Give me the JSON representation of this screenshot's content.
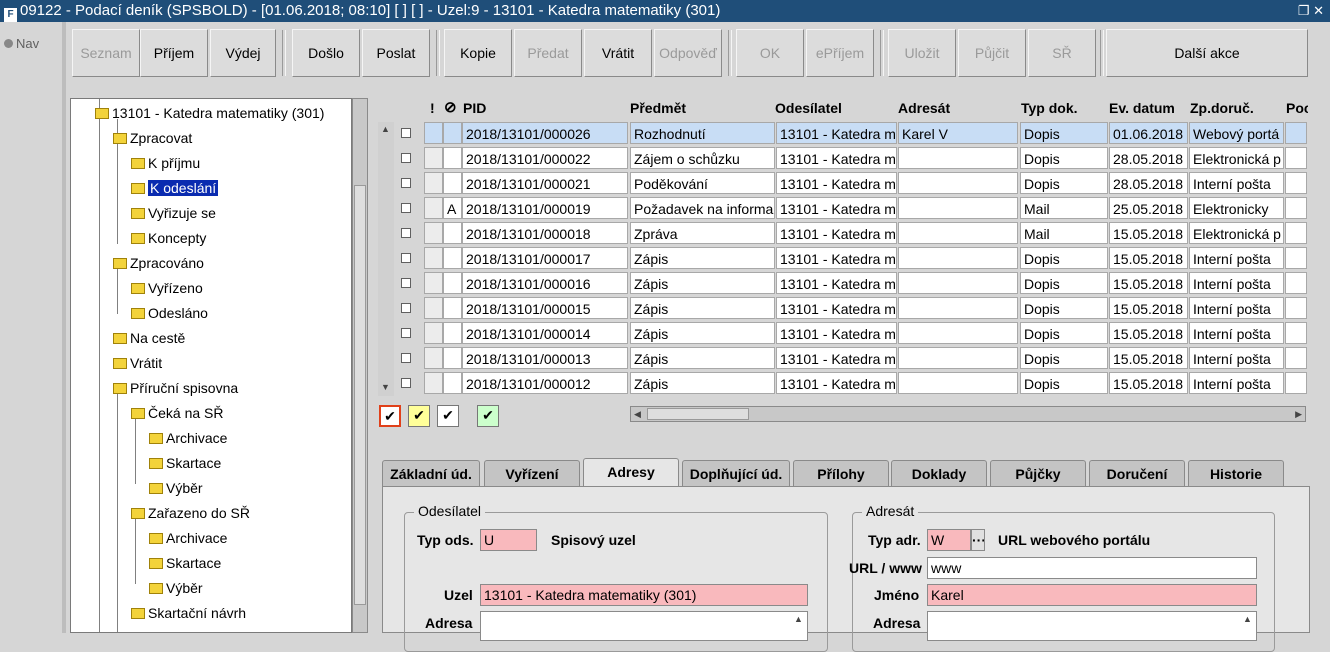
{
  "window": {
    "title": "09122 - Podací deník (SPSBOLD) - [01.06.2018; 08:10]  [ ]  [ ] - Uzel:9 - 13101 - Katedra  matematiky (301)",
    "icon": "app-icon"
  },
  "nav_label": "Nav",
  "toolbar": {
    "buttons": [
      {
        "label": "Seznam",
        "enabled": false
      },
      {
        "label": "Příjem",
        "enabled": true
      },
      {
        "label": "Výdej",
        "enabled": true
      },
      {
        "label": "Došlo",
        "enabled": true
      },
      {
        "label": "Poslat",
        "enabled": true
      },
      {
        "label": "Kopie",
        "enabled": true
      },
      {
        "label": "Předat",
        "enabled": false
      },
      {
        "label": "Vrátit",
        "enabled": true
      },
      {
        "label": "Odpověď",
        "enabled": false
      },
      {
        "label": "OK",
        "enabled": false
      },
      {
        "label": "ePříjem",
        "enabled": false
      },
      {
        "label": "Uložit",
        "enabled": false
      },
      {
        "label": "Půjčit",
        "enabled": false
      },
      {
        "label": "SŘ",
        "enabled": false
      },
      {
        "label": "Další akce",
        "enabled": true
      }
    ]
  },
  "tree": {
    "nodes": [
      {
        "label": "13101 - Katedra  matematiky (301)",
        "level": 0
      },
      {
        "label": "Zpracovat",
        "level": 1
      },
      {
        "label": "K příjmu",
        "level": 2
      },
      {
        "label": "K odeslání",
        "level": 2,
        "selected": true
      },
      {
        "label": "Vyřizuje se",
        "level": 2
      },
      {
        "label": "Koncepty",
        "level": 2
      },
      {
        "label": "Zpracováno",
        "level": 1
      },
      {
        "label": "Vyřízeno",
        "level": 2
      },
      {
        "label": "Odesláno",
        "level": 2
      },
      {
        "label": "Na cestě",
        "level": 1
      },
      {
        "label": "Vrátit",
        "level": 1
      },
      {
        "label": "Příruční spisovna",
        "level": 1
      },
      {
        "label": "Čeká na SŘ",
        "level": 2
      },
      {
        "label": "Archivace",
        "level": 3
      },
      {
        "label": "Skartace",
        "level": 3
      },
      {
        "label": "Výběr",
        "level": 3
      },
      {
        "label": "Zařazeno do SŘ",
        "level": 2
      },
      {
        "label": "Archivace",
        "level": 3
      },
      {
        "label": "Skartace",
        "level": 3
      },
      {
        "label": "Výběr",
        "level": 3
      },
      {
        "label": "Skartační návrh",
        "level": 2
      }
    ]
  },
  "grid": {
    "headers": [
      "!",
      "PID",
      "Předmět",
      "Odesílatel",
      "Adresát",
      "Typ dok.",
      "Ev. datum",
      "Zp.doruč.",
      "Poc"
    ],
    "rows": [
      {
        "flag": "",
        "pid": "2018/13101/000026",
        "predmet": "Rozhodnutí",
        "odesilatel": "13101 - Katedra  m",
        "adresat": "Karel V",
        "typ": "Dopis",
        "datum": "01.06.2018",
        "zp": "Webový portá",
        "selected": true
      },
      {
        "flag": "",
        "pid": "2018/13101/000022",
        "predmet": "Zájem o schůzku",
        "odesilatel": "13101 - Katedra  m",
        "adresat": "",
        "typ": "Dopis",
        "datum": "28.05.2018",
        "zp": "Elektronická p"
      },
      {
        "flag": "",
        "pid": "2018/13101/000021",
        "predmet": "Poděkování",
        "odesilatel": "13101 - Katedra  m",
        "adresat": "",
        "typ": "Dopis",
        "datum": "28.05.2018",
        "zp": "Interní pošta"
      },
      {
        "flag": "A",
        "pid": "2018/13101/000019",
        "predmet": "Požadavek na informa",
        "odesilatel": "13101 - Katedra  m",
        "adresat": "",
        "typ": "Mail",
        "datum": "25.05.2018",
        "zp": "Elektronicky"
      },
      {
        "flag": "",
        "pid": "2018/13101/000018",
        "predmet": "Zpráva",
        "odesilatel": "13101 - Katedra  m",
        "adresat": "",
        "typ": "Mail",
        "datum": "15.05.2018",
        "zp": "Elektronická p"
      },
      {
        "flag": "",
        "pid": "2018/13101/000017",
        "predmet": "Zápis",
        "odesilatel": "13101 - Katedra  m",
        "adresat": "",
        "typ": "Dopis",
        "datum": "15.05.2018",
        "zp": "Interní pošta"
      },
      {
        "flag": "",
        "pid": "2018/13101/000016",
        "predmet": "Zápis",
        "odesilatel": "13101 - Katedra  m",
        "adresat": "",
        "typ": "Dopis",
        "datum": "15.05.2018",
        "zp": "Interní pošta"
      },
      {
        "flag": "",
        "pid": "2018/13101/000015",
        "predmet": "Zápis",
        "odesilatel": "13101 - Katedra  m",
        "adresat": "",
        "typ": "Dopis",
        "datum": "15.05.2018",
        "zp": "Interní pošta"
      },
      {
        "flag": "",
        "pid": "2018/13101/000014",
        "predmet": "Zápis",
        "odesilatel": "13101 - Katedra  m",
        "adresat": "",
        "typ": "Dopis",
        "datum": "15.05.2018",
        "zp": "Interní pošta"
      },
      {
        "flag": "",
        "pid": "2018/13101/000013",
        "predmet": "Zápis",
        "odesilatel": "13101 - Katedra  m",
        "adresat": "",
        "typ": "Dopis",
        "datum": "15.05.2018",
        "zp": "Interní pošta"
      },
      {
        "flag": "",
        "pid": "2018/13101/000012",
        "predmet": "Zápis",
        "odesilatel": "13101 - Katedra  m",
        "adresat": "",
        "typ": "Dopis",
        "datum": "15.05.2018",
        "zp": "Interní pošta"
      }
    ]
  },
  "legend": [
    {
      "symbol": "✔",
      "border": "#e0401a",
      "bg": "#ffffff"
    },
    {
      "symbol": "✔",
      "border": "#888888",
      "bg": "#ffff99"
    },
    {
      "symbol": "✔",
      "border": "#888888",
      "bg": "#ffffff"
    },
    {
      "symbol": "✔",
      "border": "#888888",
      "bg": "#ccffcc"
    }
  ],
  "tabs": [
    {
      "label": "Základní úd.",
      "active": false
    },
    {
      "label": "Vyřízení",
      "active": false
    },
    {
      "label": "Adresy",
      "active": true
    },
    {
      "label": "Doplňující úd.",
      "active": false
    },
    {
      "label": "Přílohy",
      "active": false
    },
    {
      "label": "Doklady",
      "active": false
    },
    {
      "label": "Půjčky",
      "active": false
    },
    {
      "label": "Doručení",
      "active": false
    },
    {
      "label": "Historie",
      "active": false
    }
  ],
  "sender": {
    "group_title": "Odesílatel",
    "type_label": "Typ ods.",
    "type_value": "U",
    "type_desc": "Spisový uzel",
    "node_label": "Uzel",
    "node_value": "13101 - Katedra  matematiky (301)",
    "address_label": "Adresa"
  },
  "recipient": {
    "group_title": "Adresát",
    "type_label": "Typ adr.",
    "type_value": "W",
    "type_desc": "URL webového portálu",
    "url_label": "URL / www",
    "url_value": "www",
    "name_label": "Jméno",
    "name_value": "Karel",
    "address_label": "Adresa"
  },
  "colors": {
    "title_bar": "#1f4e79",
    "selection": "#c8ddf5",
    "required_field": "#f9b9bd",
    "tree_selected": "#0a2bb0"
  }
}
